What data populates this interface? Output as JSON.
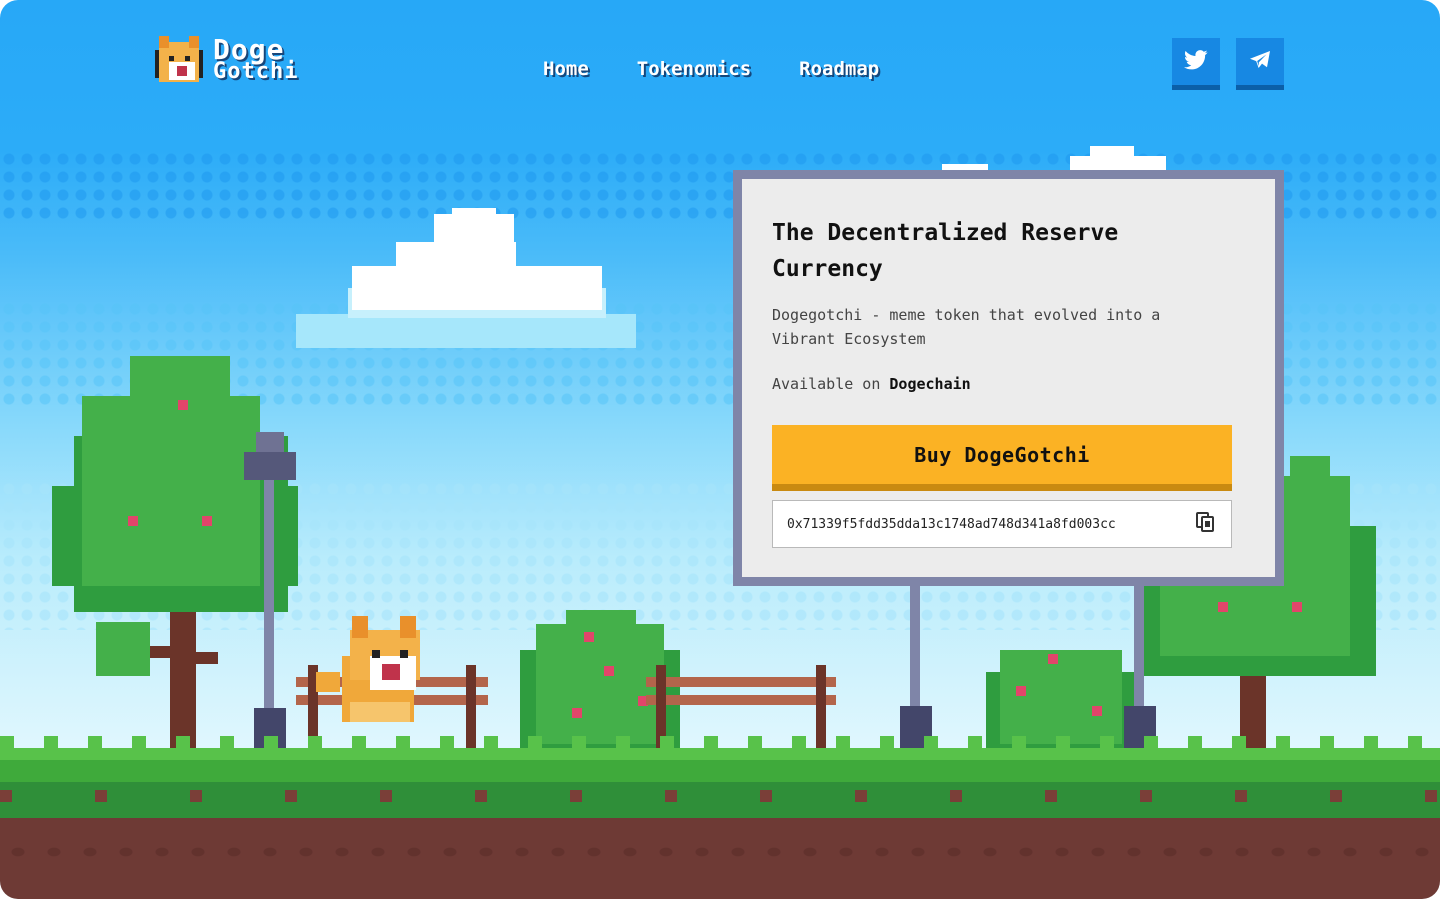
{
  "header": {
    "logo_line1": "Doge",
    "logo_line2": "Gotchi",
    "nav": [
      "Home",
      "Tokenomics",
      "Roadmap"
    ],
    "social": [
      "twitter-icon",
      "telegram-icon"
    ]
  },
  "card": {
    "title": "The Decentralized Reserve Currency",
    "description": "Dogegotchi - meme token that evolved into a Vibrant Ecosystem",
    "available_prefix": "Available on ",
    "chain": "Dogechain",
    "buy_label": "Buy DogeGotchi",
    "contract_address": "0x71339f5fdd35dda13c1748ad748d341a8fd003cc",
    "copy_icon": "copy-icon"
  },
  "colors": {
    "sky": "#27a8f7",
    "button": "#fbb224",
    "billboard_frame": "#7f85a8",
    "social_button": "#1788e3",
    "grass": "#58c24a",
    "dirt": "#6e3a35"
  }
}
